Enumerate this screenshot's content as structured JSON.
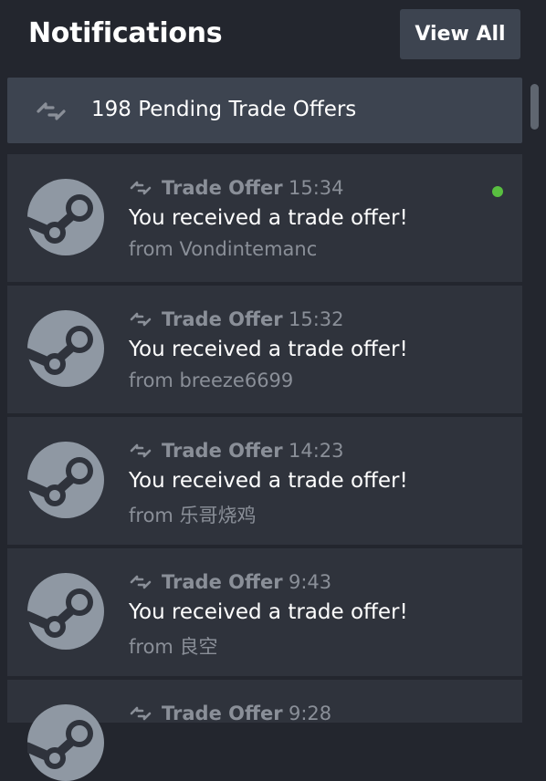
{
  "header": {
    "title": "Notifications",
    "view_all_label": "View All"
  },
  "pending": {
    "icon": "trade-arrows-icon",
    "label": "198 Pending Trade Offers"
  },
  "notifications": [
    {
      "type_icon": "trade-arrows-icon",
      "type": "Trade Offer",
      "time": "15:34",
      "message": "You received a trade offer!",
      "from": "from Vondintemanc",
      "unread": true
    },
    {
      "type_icon": "trade-arrows-icon",
      "type": "Trade Offer",
      "time": "15:32",
      "message": "You received a trade offer!",
      "from": "from breeze6699",
      "unread": false
    },
    {
      "type_icon": "trade-arrows-icon",
      "type": "Trade Offer",
      "time": "14:23",
      "message": "You received a trade offer!",
      "from": "from 乐哥烧鸡",
      "unread": false
    },
    {
      "type_icon": "trade-arrows-icon",
      "type": "Trade Offer",
      "time": "9:43",
      "message": "You received a trade offer!",
      "from": "from 良空",
      "unread": false
    },
    {
      "type_icon": "trade-arrows-icon",
      "type": "Trade Offer",
      "time": "9:28",
      "message": "",
      "from": "",
      "unread": false
    }
  ],
  "colors": {
    "background": "#23262e",
    "card": "#2f333c",
    "button": "#3d4450",
    "muted_text": "#8a8f98",
    "unread_dot": "#59bf40",
    "steam_logo": "#8f98a3"
  }
}
